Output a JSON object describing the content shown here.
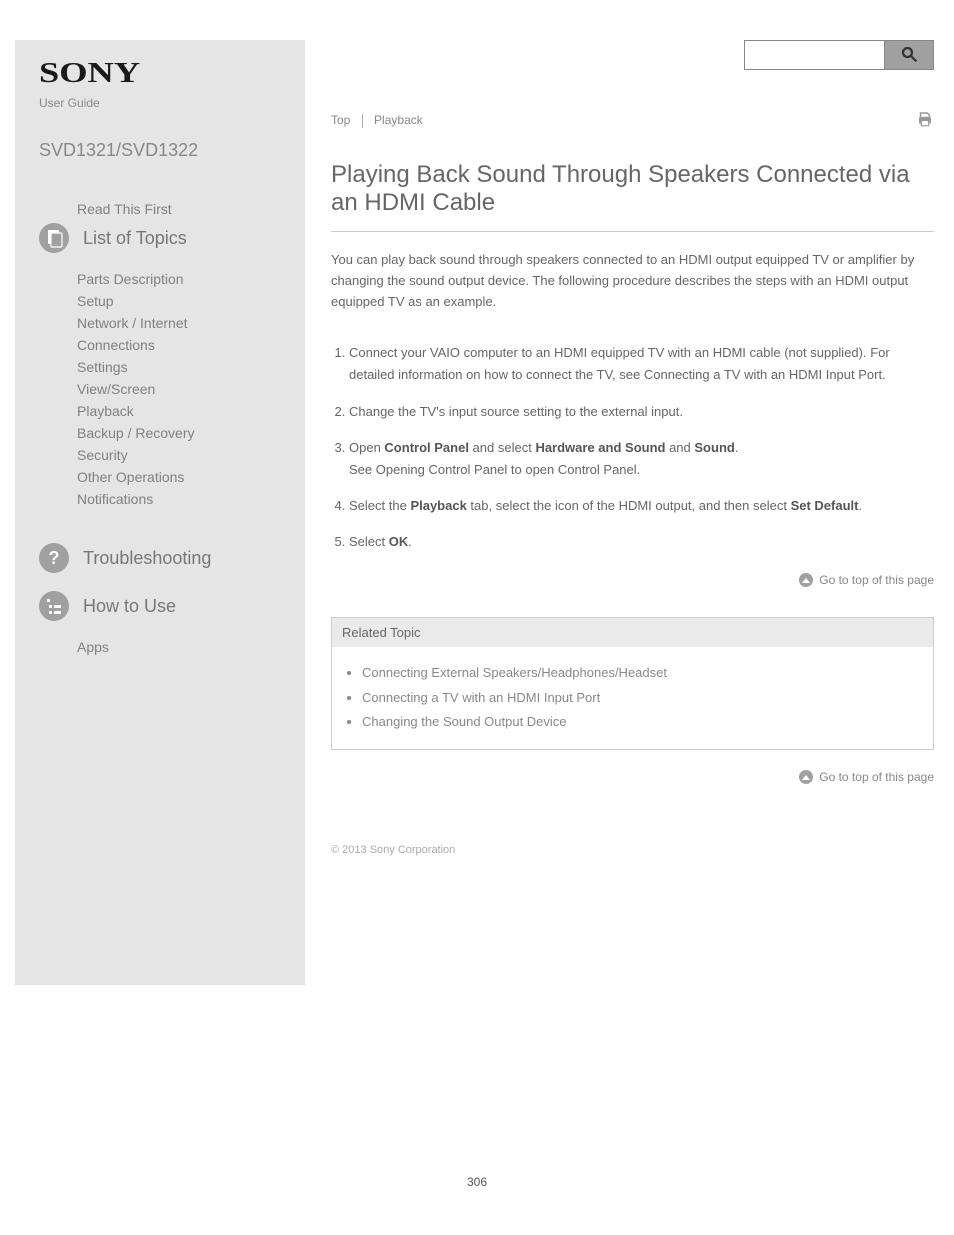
{
  "logo": "SONY",
  "subline": "User Guide",
  "model": "SVD1321/SVD1322",
  "sidebar": {
    "readFirst": "Read This First",
    "groups": [
      {
        "label": "List of Topics",
        "items": [
          "Parts Description",
          "Setup",
          "Network / Internet",
          "Connections",
          "Settings",
          "View/Screen",
          "Playback",
          "Backup / Recovery",
          "Security",
          "Other Operations",
          "Notifications"
        ]
      },
      {
        "label": "Troubleshooting",
        "items": []
      },
      {
        "label": "How to Use",
        "items": []
      },
      {
        "label": "Apps",
        "items": []
      }
    ]
  },
  "search": {
    "placeholder": ""
  },
  "breadcrumb": {
    "a": "Top",
    "b": "Playback"
  },
  "printLabel": "",
  "article": {
    "title": "Playing Back Sound Through Speakers Connected via an HDMI Cable",
    "p1": "You can play back sound through speakers connected to an HDMI output equipped TV or amplifier by changing the sound output device. The following procedure describes the steps with an HDMI output equipped TV as an example.",
    "steps": [
      {
        "pre": "Connect your VAIO computer to an HDMI equipped TV with an HDMI cable (not supplied). For detailed information on how to connect the TV, see ",
        "link": "Connecting a TV with an HDMI Input Port",
        "post": "."
      },
      {
        "pre": "Change the TV's input source setting to the external input.",
        "link": "",
        "post": ""
      },
      {
        "pre": "Open ",
        "strong1": "Control Panel",
        "mid1": " and select ",
        "strong2": "Hardware and Sound",
        "mid2": " and ",
        "strong3": "Sound",
        "end": ".",
        "extra": "",
        "link": "See Opening Control Panel",
        "extraEnd": " to open Control Panel."
      },
      {
        "pre": "Select the ",
        "strong1": "Playback",
        "mid1": " tab, select the icon of the HDMI output, and then select ",
        "strong2": "Set Default",
        "end": "."
      },
      {
        "pre": "Select ",
        "strong1": "OK",
        "end": "."
      }
    ]
  },
  "gotop": "Go to top of this page",
  "related": {
    "title": "Related Topic",
    "items": [
      "Connecting External Speakers/Headphones/Headset",
      "Connecting a TV with an HDMI Input Port",
      "Changing the Sound Output Device"
    ]
  },
  "copyright": "© 2013 Sony Corporation",
  "pageNumber": "306"
}
